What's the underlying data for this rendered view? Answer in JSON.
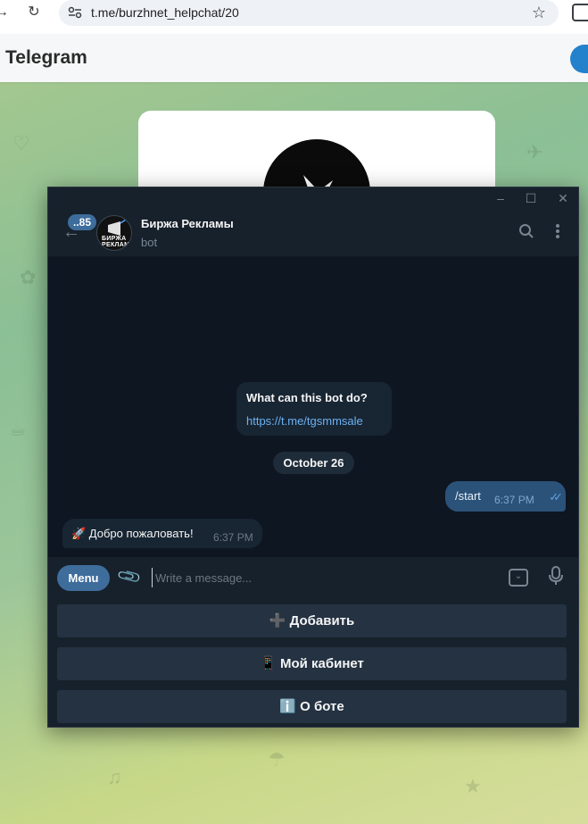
{
  "browser": {
    "url": "t.me/burzhnet_helpchat/20",
    "back_icon": "arrow-back-icon",
    "reload_icon": "reload-icon",
    "bookmark_icon": "star-icon"
  },
  "page": {
    "title": "Telegram"
  },
  "window": {
    "minimize": "–",
    "maximize": "☐",
    "close": "✕"
  },
  "chat": {
    "unread_count": "..85",
    "name": "Биржа Рекламы",
    "status": "bot",
    "avatar_text": "БИРЖА РЕКЛАМЫ"
  },
  "messages": {
    "intro_title": "What can this bot do?",
    "intro_link": "https://t.me/tgsmmsale",
    "date": "October 26",
    "outgoing": {
      "text": "/start",
      "time": "6:37 PM"
    },
    "incoming": {
      "text": "🚀 Добро пожаловать!",
      "time": "6:37 PM"
    }
  },
  "composer": {
    "menu_label": "Menu",
    "placeholder": "Write a message..."
  },
  "keyboard": {
    "buttons": [
      "➕ Добавить",
      "📱 Мой кабинет",
      "ℹ️ О боте"
    ]
  },
  "colors": {
    "accent": "#3e6d9c",
    "window_bg": "#0e1621",
    "link": "#6ab3f3"
  }
}
